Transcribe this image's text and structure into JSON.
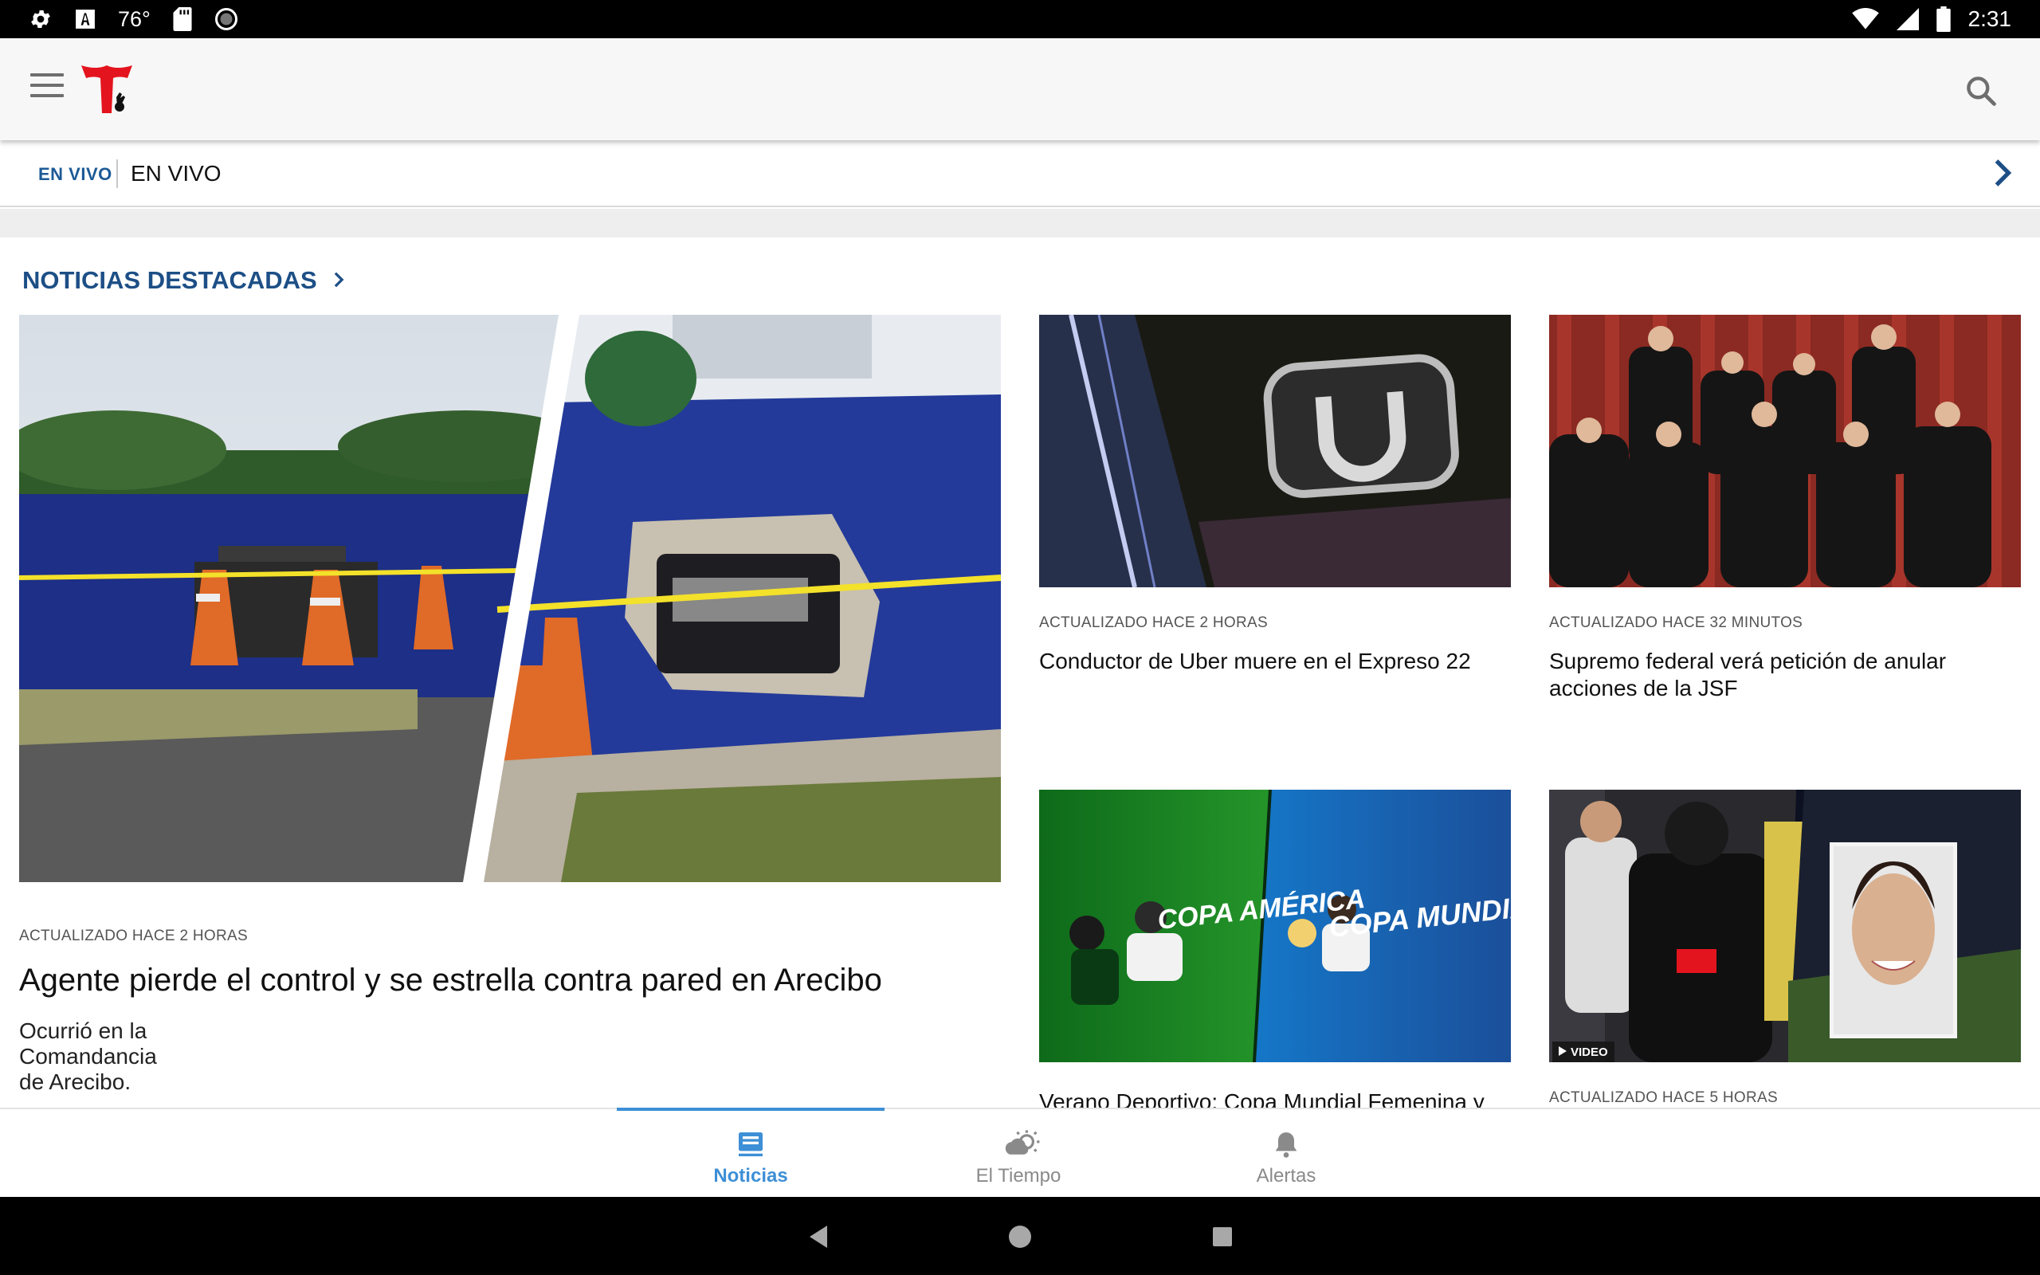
{
  "status_bar": {
    "temperature": "76°",
    "time": "2:31"
  },
  "app_bar": {
    "logo_alt": "Telemundo"
  },
  "live": {
    "tag": "EN VIVO",
    "title": "EN VIVO"
  },
  "section": {
    "title": "NOTICIAS DESTACADAS"
  },
  "featured": {
    "meta": "ACTUALIZADO HACE 2 HORAS",
    "headline": "Agente pierde el control y se estrella contra pared en Arecibo",
    "summary": "Ocurrió en la Comandancia de Arecibo."
  },
  "cards": [
    {
      "meta": "ACTUALIZADO HACE 2 HORAS",
      "headline": "Conductor de Uber muere en el Expreso 22"
    },
    {
      "meta": "ACTUALIZADO HACE 32 MINUTOS",
      "headline": "Supremo federal verá petición de anular acciones de la JSF"
    },
    {
      "meta": "",
      "headline": "Verano Deportivo: Copa Mundial Femenina y",
      "image_text_left": "COPA AMÉRICA",
      "image_text_right": "COPA MUNDIAL"
    },
    {
      "meta": "ACTUALIZADO HACE 5 HORAS",
      "headline": "",
      "badge": "VIDEO"
    }
  ],
  "bottom_nav": [
    {
      "label": "Noticias",
      "icon": "news-icon",
      "active": true
    },
    {
      "label": "El Tiempo",
      "icon": "weather-icon",
      "active": false
    },
    {
      "label": "Alertas",
      "icon": "bell-icon",
      "active": false
    }
  ],
  "colors": {
    "accent": "#3d8fd6",
    "brand_blue": "#1d4f86",
    "brand_red": "#e4141e"
  }
}
